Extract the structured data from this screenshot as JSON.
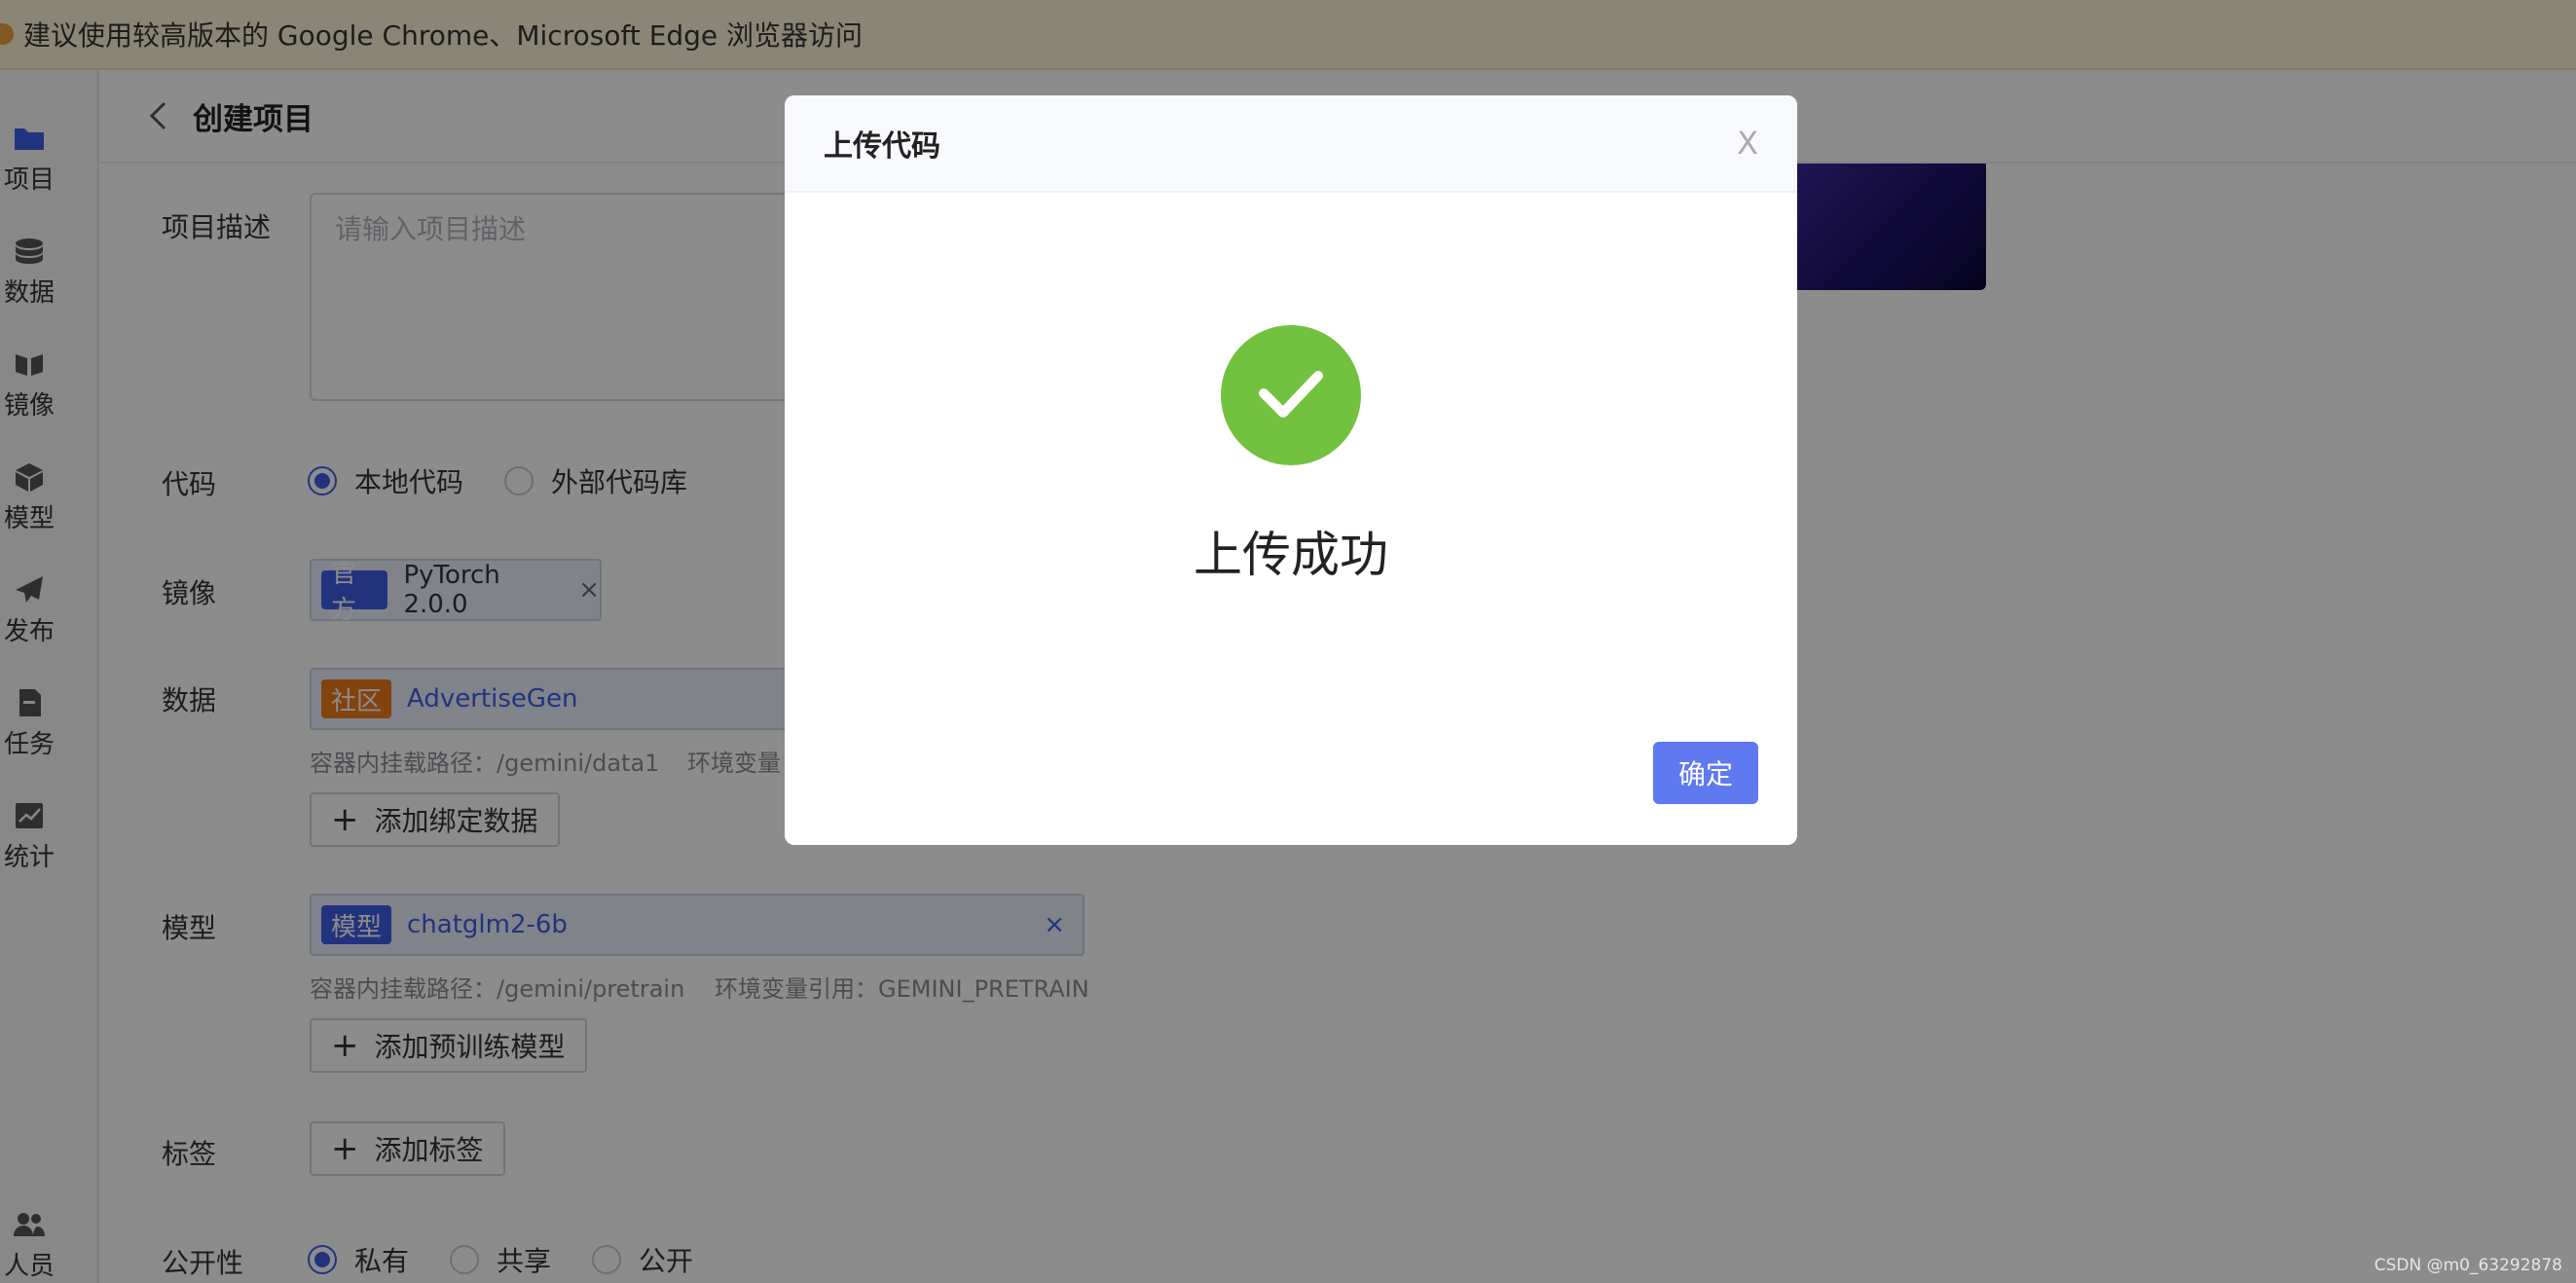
{
  "notice": {
    "text": "建议使用较高版本的 Google Chrome、Microsoft Edge 浏览器访问"
  },
  "sidebar": {
    "items": [
      {
        "label": "项目",
        "icon": "folder-icon"
      },
      {
        "label": "数据",
        "icon": "database-icon"
      },
      {
        "label": "镜像",
        "icon": "mirror-icon"
      },
      {
        "label": "模型",
        "icon": "cube-icon"
      },
      {
        "label": "发布",
        "icon": "send-icon"
      },
      {
        "label": "任务",
        "icon": "task-icon"
      },
      {
        "label": "统计",
        "icon": "chart-icon"
      }
    ],
    "bottom_item": {
      "label": "人员",
      "icon": "users-icon"
    }
  },
  "header": {
    "title": "创建项目"
  },
  "form": {
    "description": {
      "label": "项目描述",
      "placeholder": "请输入项目描述"
    },
    "code": {
      "label": "代码",
      "options": [
        "本地代码",
        "外部代码库"
      ],
      "selected": "本地代码"
    },
    "image": {
      "label": "镜像",
      "badge": "官方",
      "value": "PyTorch 2.0.0",
      "close": "×"
    },
    "data": {
      "label": "数据",
      "badge": "社区",
      "value": "AdvertiseGen",
      "hint_path": "容器内挂载路径：/gemini/data1",
      "hint_env": "环境变量",
      "add_label": "添加绑定数据"
    },
    "model": {
      "label": "模型",
      "badge": "模型",
      "value": "chatglm2-6b",
      "close": "×",
      "hint_path": "容器内挂载路径：/gemini/pretrain",
      "hint_env": "环境变量引用：GEMINI_PRETRAIN",
      "add_label": "添加预训练模型"
    },
    "tags": {
      "label": "标签",
      "add_label": "添加标签"
    },
    "visibility": {
      "label": "公开性",
      "options": [
        "私有",
        "共享",
        "公开"
      ],
      "selected": "私有"
    }
  },
  "modal": {
    "title": "上传代码",
    "close": "X",
    "message": "上传成功",
    "ok_label": "确定"
  },
  "watermark": "CSDN @m0_63292878",
  "colors": {
    "primary": "#3f5ee6",
    "success": "#72c240",
    "community": "#ee7a1a",
    "ok_button": "#5f79f0"
  }
}
